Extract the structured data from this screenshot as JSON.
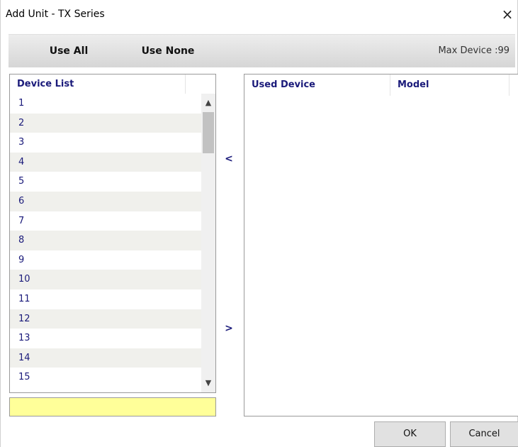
{
  "window": {
    "title": "Add Unit - TX Series",
    "close_label": "×"
  },
  "toolbar": {
    "use_all": "Use All",
    "use_none": "Use None",
    "max_device": "Max Device :99"
  },
  "device_list": {
    "header": "Device List",
    "items": [
      "1",
      "2",
      "3",
      "4",
      "5",
      "6",
      "7",
      "8",
      "9",
      "10",
      "11",
      "12",
      "13",
      "14",
      "15"
    ]
  },
  "scrollbar": {
    "up": "^",
    "down": "v"
  },
  "transfer": {
    "left": "<",
    "right": ">"
  },
  "used_table": {
    "columns": [
      "Used Device",
      "Model"
    ]
  },
  "buttons": {
    "ok": "OK",
    "cancel": "Cancel"
  }
}
